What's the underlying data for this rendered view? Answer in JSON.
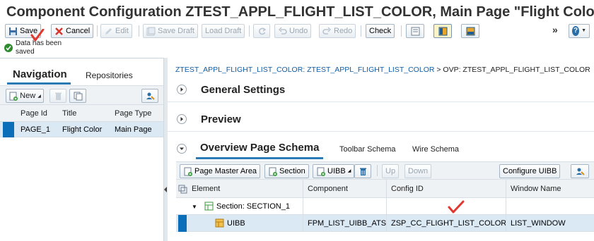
{
  "window": {
    "title": "Component Configuration ZTEST_APPL_FLIGHT_LIST_COLOR, Main Page \"Flight Color\""
  },
  "toolbar": {
    "save": "Save",
    "cancel": "Cancel",
    "edit": "Edit",
    "save_draft": "Save Draft",
    "load_draft": "Load Draft",
    "undo": "Undo",
    "redo": "Redo",
    "check": "Check",
    "more": "»"
  },
  "message": {
    "text": "Data has been saved",
    "status_color": "#2e8b2e"
  },
  "left_panel": {
    "tab_navigation": "Navigation",
    "tab_repositories": "Repositories",
    "new_button": "New",
    "columns": [
      "Page Id",
      "Title",
      "Page Type"
    ],
    "rows": [
      {
        "page_id": "PAGE_1",
        "title": "Flight Color",
        "page_type": "Main Page"
      }
    ]
  },
  "right_panel": {
    "breadcrumb_link": "ZTEST_APPL_FLIGHT_LIST_COLOR: ZTEST_APPL_FLIGHT_LIST_COLOR",
    "breadcrumb_rest": " > OVP: ZTEST_APPL_FLIGHT_LIST_COLOR",
    "sections": {
      "general_settings": "General Settings",
      "preview": "Preview",
      "overview_schema": "Overview Page Schema"
    },
    "tabs": {
      "toolbar_schema": "Toolbar Schema",
      "wire_schema": "Wire Schema"
    },
    "schema_toolbar": {
      "page_master_area": "Page Master Area",
      "section": "Section",
      "uibb": "UIBB",
      "up": "Up",
      "down": "Down",
      "configure_uibb": "Configure UIBB"
    },
    "columns": [
      "Element",
      "Component",
      "Config ID",
      "Window Name"
    ],
    "rows": [
      {
        "element": "Section: SECTION_1",
        "component": "",
        "config_id": "",
        "window_name": ""
      },
      {
        "element": "UIBB",
        "component": "FPM_LIST_UIBB_ATS",
        "config_id": "ZSP_CC_FLIGHT_LIST_COLOR",
        "window_name": "LIST_WINDOW"
      }
    ]
  },
  "colors": {
    "accent": "#2a7ab8",
    "selection": "#0a6fb8",
    "selected_row": "#dbe9f5",
    "annotation": "#e0382e"
  }
}
